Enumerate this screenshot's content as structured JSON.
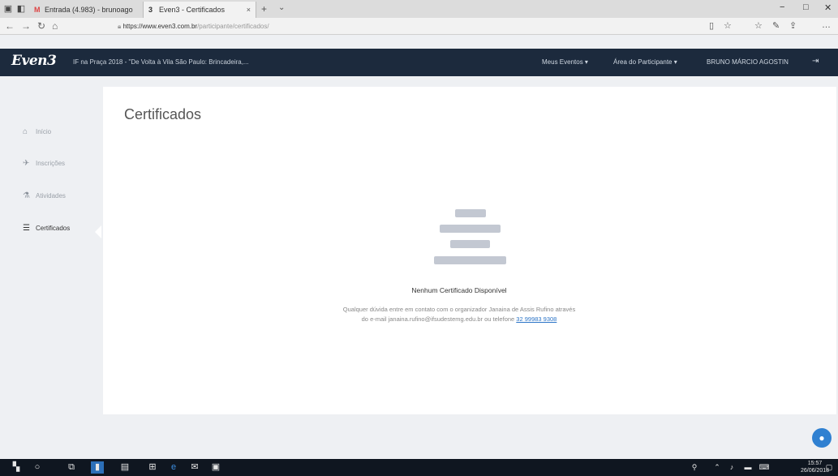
{
  "browser": {
    "tabs": [
      {
        "label": "Entrada (4.983) - brunoago",
        "favicon": "M"
      },
      {
        "label": "Even3 - Certificados",
        "favicon": "3"
      }
    ],
    "new_tab": "+",
    "tab_menu": "⌄",
    "close_glyph": "×",
    "url_domain": "https://www.even3.com.br",
    "url_path": "/participante/certificados/",
    "window_controls": {
      "minimize": "−",
      "maximize": "□",
      "close": "✕"
    }
  },
  "header": {
    "logo": "Even3",
    "event_name": "IF na Praça 2018 - \"De Volta à Vila São Paulo: Brincadeira,...",
    "menu_events": "Meus Eventos ▾",
    "menu_participant": "Área do Participante ▾",
    "user_name": "BRUNO MÁRCIO AGOSTIN"
  },
  "sidebar": {
    "items": [
      {
        "label": "Início",
        "icon": "home-icon"
      },
      {
        "label": "Inscrições",
        "icon": "ticket-icon"
      },
      {
        "label": "Atividades",
        "icon": "flask-icon"
      },
      {
        "label": "Certificados",
        "icon": "certificate-icon"
      }
    ]
  },
  "main": {
    "title": "Certificados",
    "empty_title": "Nenhum Certificado Disponível",
    "empty_msg_line1": "Qualquer dúvida entre em contato com o organizador Janaina de Assis Rufino através",
    "empty_msg_line2": "do e-mail janaina.rufino@ifsudestemg.edu.br ou telefone ",
    "phone": "32 99983 9308"
  },
  "taskbar": {
    "time": "15:57",
    "date": "26/06/2018"
  },
  "colors": {
    "appbar": "#1c2a3d",
    "accent": "#2f80d1",
    "placeholder_bars": "#c3c8d2"
  }
}
